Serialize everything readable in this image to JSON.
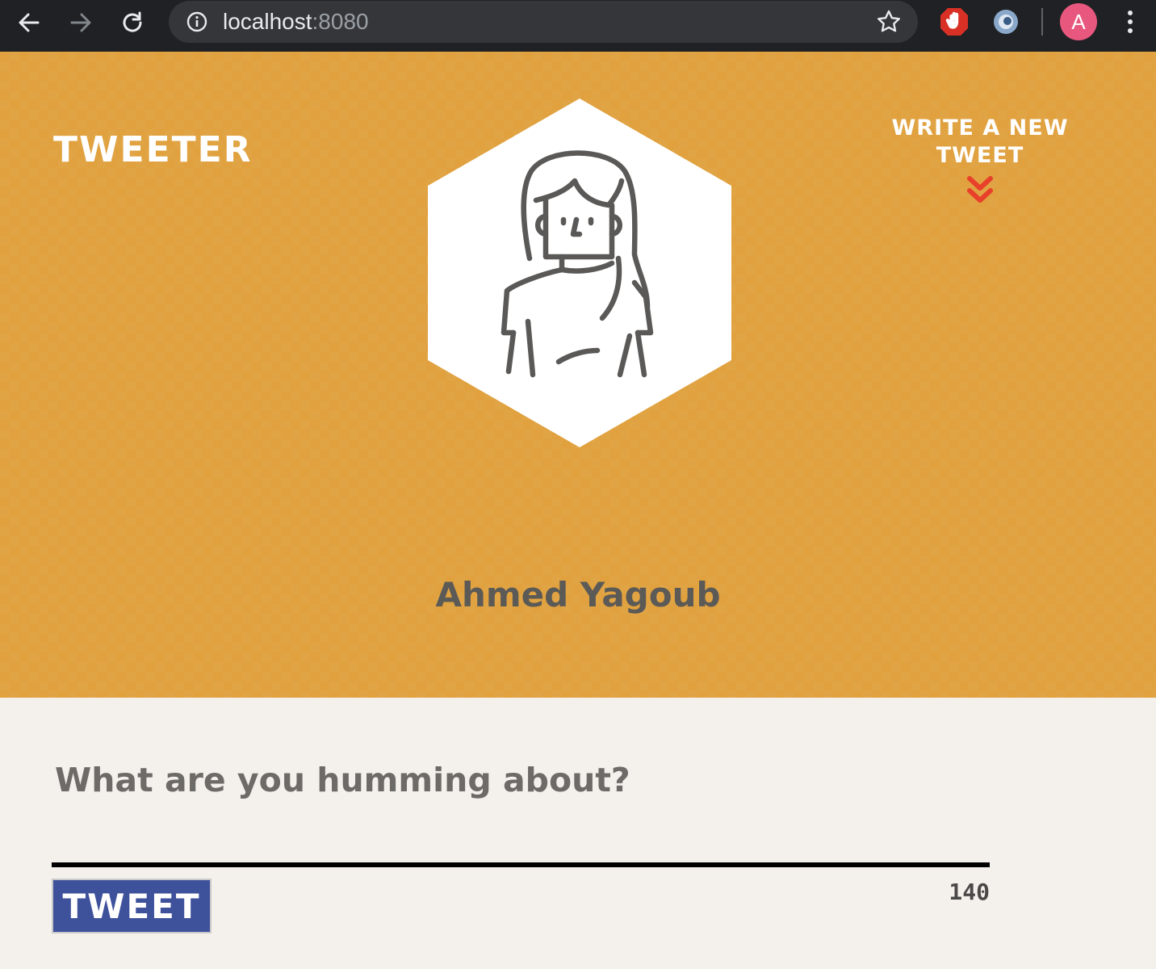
{
  "browser": {
    "url_host": "localhost",
    "url_port": ":8080",
    "profile_initial": "A",
    "icons": {
      "back": "back-arrow-icon",
      "forward": "forward-arrow-icon",
      "reload": "reload-icon",
      "info": "info-icon",
      "star": "bookmark-star-icon",
      "adblock": "adblock-hand-icon",
      "extension": "extension-swirl-icon",
      "menu": "kebab-menu-icon"
    },
    "colors": {
      "chrome_bg": "#202124",
      "omnibox_bg": "#35363a",
      "avatar_bg": "#e8577e",
      "adblock_red": "#d93025"
    }
  },
  "header": {
    "brand": "Tweeter",
    "compose_link": "Write a new tweet",
    "compose_icon": "double-chevron-down-icon",
    "avatar_icon": "woman-avatar-icon",
    "username": "Ahmed Yagoub",
    "colors": {
      "background": "#e0a13e",
      "chevron": "#e8402a",
      "username": "#5b5a57"
    }
  },
  "compose": {
    "placeholder": "What are you humming about?",
    "value": "",
    "button_label": "Tweet",
    "char_count": "140",
    "colors": {
      "button_bg": "#3e519b",
      "background": "#f4f1ed"
    }
  }
}
